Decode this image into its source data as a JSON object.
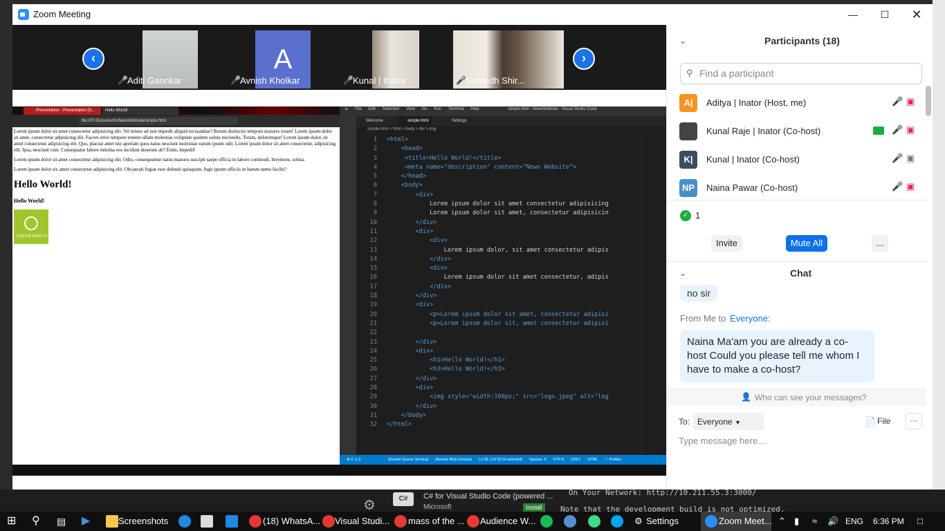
{
  "window": {
    "title": "Zoom Meeting"
  },
  "gallery": {
    "tiles": [
      {
        "name": "Aditi Gaonkar"
      },
      {
        "name": "Avnish Kholkar",
        "initial": "A"
      },
      {
        "name": "Kunal | Inator"
      },
      {
        "name": "Sumedh Shir..."
      }
    ]
  },
  "browser": {
    "tab1": "Presentation - Presentation [S...",
    "tab2": "Hello World!",
    "url": "file:///F:/Documents/NewsWebsite/simple.html",
    "p1": "Lorem ipsum dolor sit amet consectetur adipisicing elit. Vel minus ad non impedit aliquid recusandae? Rerum distinctio tempora maiores totam! Lorem ipsum dolor sit amet, consectetur adipisicing elit. Facere error tempore tenetur ullam molestias voluptate quidem soluta reiciendis. Totam, doloremque! Lorem ipsum dolor, sit amet consectetur adipisicing elit. Quo, placeat amet iste aperiam quos natus nesciunt molestiae earum ipsum odit. Lorem ipsum dolor sit amet consectetur, adipisicing elit. Ipsa, nesciunt cum. Consequatur labore minima eos incidunt deserunt ab? Enim, impedit!",
    "p2": "Lorem ipsum dolor sit amet consectetur adipisicing elit. Odio, consequuntur natus maiores suscipit saepe officia in labore commodi. Inventore, soluta.",
    "p3": "Lorem ipsum dolor sit, amet consectetur adipisicing elit. Obcaecati fugiat esse deleniti quisquam, fugit ipsum officiis ut harum nemo facilis?",
    "h1": "Hello World!",
    "h3": "Hello World!",
    "logo_text": "GOETHE INSTITUT"
  },
  "vscode": {
    "menu": [
      "File",
      "Edit",
      "Selection",
      "View",
      "Go",
      "Run",
      "Terminal",
      "Help"
    ],
    "title": "simple.html - NewsWebsite - Visual Studio Code",
    "tabs": [
      "Welcome",
      "simple.html",
      "Settings"
    ],
    "breadcrumb": "simple.html > html > body > div > img",
    "code": [
      "<html>",
      "    <head>",
      "     <title>Hello World!</title>",
      "     <meta name=\"description\" content=\"News Website\">",
      "    </head>",
      "    <body>",
      "        <div>",
      "            Lorem ipsum dolor sit amet consectetur adipisicing",
      "            Lorem ipsum dolor sit amet, consectetur adipisicin",
      "        </div>",
      "        <div>",
      "            <div>",
      "                Lorem ipsum dolor, sit amet consectetur adipis",
      "            </div>",
      "            <div>",
      "                Lorem ipsum dolor sit amet consectetur, adipis",
      "            </div>",
      "        </div>",
      "        <div>",
      "            <p>Lorem ipsum dolor sit amet, consectetur adipisi",
      "            <p>Lorem ipsum dolor sit, amet consectetur adipisi",
      "",
      "        </div>",
      "        <div>",
      "            <h1>Hello World!</h1>",
      "            <h3>Hello World!</h3>",
      "        </div>",
      "        <div>",
      "            <img style=\"width:100px;\" src=\"logo.jpeg\" alt=\"log",
      "        </div>",
      "    </body>",
      "</html>"
    ],
    "status": [
      "⊗ 0 ⚠ 0",
      "[Azurite Queue Service]",
      "[Azurite Blob Service]",
      "Ln 29, Col 53 (9 selected)",
      "Spaces: 4",
      "UTF-8",
      "CRLF",
      "HTML",
      "✓ Prettier"
    ]
  },
  "participants": {
    "header": "Participants (18)",
    "search_placeholder": "Find a participant",
    "list": [
      {
        "initials": "A|",
        "name": "Aditya | Inator (Host, me)",
        "color": "#f7931e"
      },
      {
        "initials": "",
        "name": "Kunal Raje | Inator (Co-host)",
        "color": "#444444"
      },
      {
        "initials": "K|",
        "name": "Kunal | Inator (Co-host)",
        "color": "#3b4d61"
      },
      {
        "initials": "NP",
        "name": "Naina Pawar (Co-host)",
        "color": "#4a90c8"
      }
    ],
    "raised_count": "1",
    "invite": "Invite",
    "mute_all": "Mute All",
    "more": "..."
  },
  "chat": {
    "header": "Chat",
    "prev_msg": "no sir",
    "from_prefix": "From Me to ",
    "from_target": "Everyone:",
    "message": "Naina Ma'am you are already a co-host Could you please tell me whom I have to make a co-host?",
    "who_can_see": "Who can see your messages?",
    "to_label": "To:",
    "to_value": "Everyone",
    "file_label": "File",
    "input_placeholder": "Type message here..."
  },
  "background": {
    "ext_title": "C# for Visual Studio Code (powered ...",
    "ext_pub": "Microsoft",
    "install": "Install",
    "term1": "On Your Network:  http://10.211.55.3:3000/",
    "term2": "Note that the development build is not optimized."
  },
  "taskbar": {
    "items": [
      "Screenshots",
      "(18) WhatsA...",
      "Visual Studi...",
      "mass of the ...",
      "Audience W...",
      "Settings",
      "Zoom Meet..."
    ],
    "lang": "ENG",
    "time": "6:36 PM"
  }
}
